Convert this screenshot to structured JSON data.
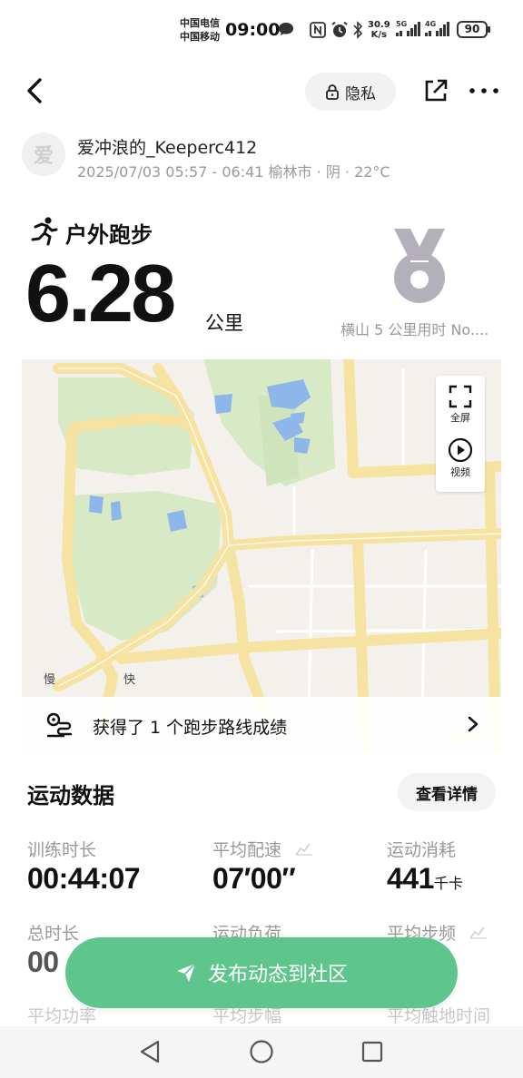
{
  "status_bar": {
    "carrier1": "中国电信",
    "carrier2": "中国移动",
    "time": "09:00",
    "net_speed_value": "30.9",
    "net_speed_unit": "K/s",
    "sig1_label": "5G",
    "sig2_label": "4G",
    "battery": "90"
  },
  "header": {
    "privacy_label": "隐私"
  },
  "user": {
    "avatar_text": "爱",
    "name": "爱冲浪的_Keeperc412",
    "meta": "2025/07/03 05:57 - 06:41 榆林市 · 阴 · 22°C"
  },
  "activity": {
    "type": "户外跑步",
    "distance": "6.28",
    "unit": "公里",
    "medal_caption": "横山 5 公里用时 No...."
  },
  "map": {
    "fullscreen_label": "全屏",
    "video_label": "视频",
    "legend_slow": "慢",
    "legend_fast": "快",
    "route_text": "获得了 1 个跑步路线成绩"
  },
  "stats": {
    "title": "运动数据",
    "details_label": "查看详情",
    "items": [
      {
        "label": "训练时长",
        "value": "00:44:07",
        "unit": ""
      },
      {
        "label": "平均配速",
        "value": "07′00″",
        "unit": ""
      },
      {
        "label": "运动消耗",
        "value": "441",
        "unit": "千卡"
      },
      {
        "label": "总时长",
        "value": "00",
        "unit": ""
      },
      {
        "label": "运动负荷",
        "value": "",
        "unit": ""
      },
      {
        "label": "平均步频",
        "value": "",
        "unit": ""
      }
    ],
    "faded_row": [
      "平均功率",
      "平均步幅",
      "平均触地时间"
    ]
  },
  "publish_label": "发布动态到社区",
  "icons": {
    "status": [
      "message-icon",
      "nfc-icon",
      "alarm-icon",
      "bluetooth-icon",
      "signal-icon",
      "battery-icon"
    ],
    "header": [
      "back-arrow-icon",
      "lock-icon",
      "share-icon",
      "more-icon"
    ],
    "activity": [
      "running-person-icon",
      "medal-icon"
    ],
    "map": [
      "fullscreen-icon",
      "play-icon",
      "route-pin-icon",
      "chevron-right-icon"
    ],
    "publish": [
      "send-icon"
    ],
    "nav": [
      "nav-back-icon",
      "nav-home-icon",
      "nav-recent-icon"
    ]
  },
  "colors": {
    "accent_green": "#5ec68d",
    "map_road": "#f7e3a1",
    "map_park": "#d7e9c5",
    "map_water": "#8fb6e8",
    "medal_gray": "#b4b0bb"
  }
}
